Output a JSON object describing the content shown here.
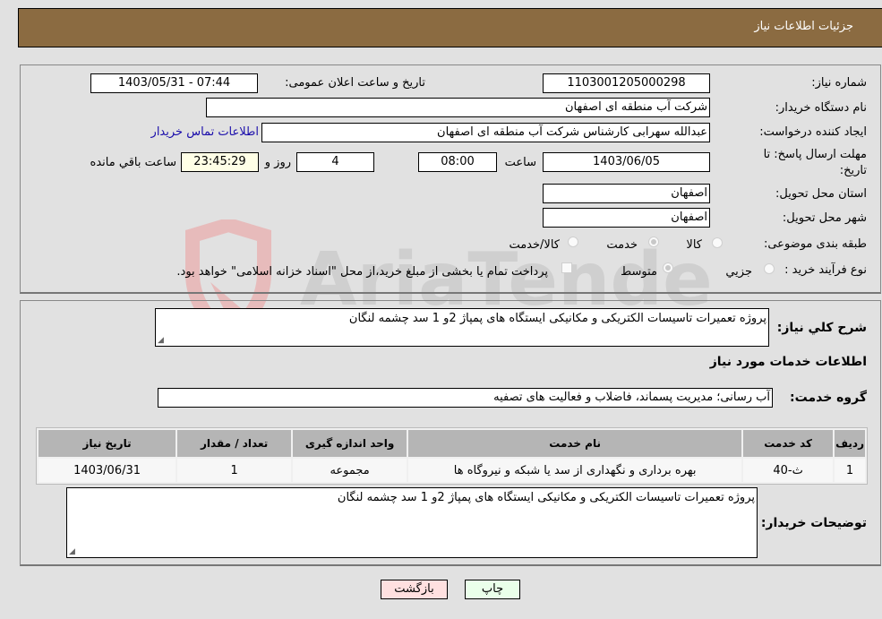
{
  "header": {
    "title": "جزئیات اطلاعات نیاز"
  },
  "fields": {
    "need_number": {
      "label": "شماره نیاز:",
      "value": "1103001205000298"
    },
    "announce_datetime": {
      "label": "تاریخ و ساعت اعلان عمومی:",
      "value": "1403/05/31 - 07:44"
    },
    "buyer_org": {
      "label": "نام دستگاه خریدار:",
      "value": "شرکت آب منطقه ای اصفهان"
    },
    "requester": {
      "label": "ایجاد کننده درخواست:",
      "value": "عبدالله سهرابی کارشناس شرکت آب منطقه ای اصفهان"
    },
    "buyer_contact_link": "اطلاعات تماس خریدار",
    "deadline": {
      "label_line1": "مهلت ارسال پاسخ: تا",
      "label_line2": "تاریخ:",
      "date": "1403/06/05",
      "time_label": "ساعت",
      "time": "08:00",
      "days": "4",
      "days_label": "روز و",
      "remaining": "23:45:29",
      "remaining_label": "ساعت باقي مانده"
    },
    "province": {
      "label": "استان محل تحویل:",
      "value": "اصفهان"
    },
    "city": {
      "label": "شهر محل تحویل:",
      "value": "اصفهان"
    },
    "category": {
      "label": "طبقه بندی موضوعی:",
      "options": [
        "کالا",
        "خدمت",
        "کالا/خدمت"
      ],
      "selected": "خدمت"
    },
    "process_type": {
      "label": "نوع فرآیند خرید :",
      "options": [
        "جزیي",
        "متوسط"
      ],
      "selected": "متوسط",
      "treasury_note": "پرداخت تمام یا بخشی از مبلغ خرید،از محل \"اسناد خزانه اسلامی\" خواهد بود."
    }
  },
  "general_description": {
    "label": "شرح کلي نیاز:",
    "value": "پروژه  تعمیرات تاسیسات الکتریکی و مکانیکی ایستگاه های پمپاژ 2و 1 سد چشمه لنگان"
  },
  "services_section_title": "اطلاعات خدمات مورد نیاز",
  "service_group": {
    "label": "گروه خدمت:",
    "value": "آب رسانی؛ مدیریت پسماند، فاضلاب و فعالیت های تصفیه"
  },
  "table": {
    "headers": [
      "ردیف",
      "کد خدمت",
      "نام خدمت",
      "واحد اندازه گیری",
      "تعداد / مقدار",
      "تاریخ نیاز"
    ],
    "rows": [
      [
        "1",
        "ث-40",
        "بهره برداری و نگهداری از سد یا شبکه و نیروگاه ها",
        "مجموعه",
        "1",
        "1403/06/31"
      ]
    ]
  },
  "buyer_notes": {
    "label": "توضیحات خریدار:",
    "value": "پروژه  تعمیرات تاسیسات الکتریکی و مکانیکی ایستگاه های پمپاژ 2و 1 سد چشمه لنگان"
  },
  "buttons": {
    "print": "چاپ",
    "back": "بازگشت"
  },
  "watermark": {
    "text": "AriaTender.neT",
    "colors": {
      "shield": "#e8b4b4",
      "text": "#c9c9c9"
    }
  }
}
